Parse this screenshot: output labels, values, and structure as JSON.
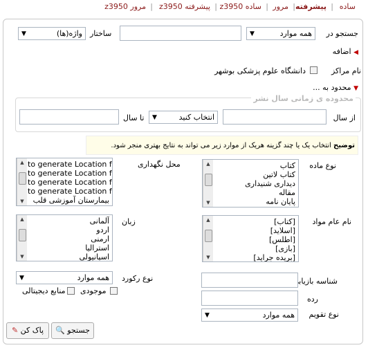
{
  "tabs": [
    {
      "label": "ساده"
    },
    {
      "label": "پیشرفته"
    },
    {
      "label": "مرور"
    },
    {
      "label": "z3950 ساده"
    },
    {
      "label": "z3950 پیشرفته"
    },
    {
      "label": "z3950 مرور"
    }
  ],
  "search": {
    "search_in_label": "جستجو در",
    "search_in_value": "همه موارد",
    "query_value": "",
    "structure_label": "ساختار",
    "structure_value": "واژه(ها)",
    "add_label": "اضافه"
  },
  "centers": {
    "label": "نام مراکز",
    "option": "دانشگاه علوم پزشکی بوشهر",
    "limit_label": "محدود به ..."
  },
  "year_range": {
    "legend": "محدوده ی زمانی سال نشر",
    "from_label": "از سال",
    "select_value": "انتخاب کنید",
    "to_label": "تا سال"
  },
  "hint": {
    "title": "توضیح",
    "text": "انتخاب یک یا چند گزینه هریک از موارد زیر می تواند به نتایج بهتری منجر شود."
  },
  "material_type": {
    "label": "نوع ماده",
    "items": [
      "کتاب",
      "کتاب لاتین",
      "دیداری شنیداری",
      "مقاله",
      "پایان نامه"
    ]
  },
  "location": {
    "label": "محل نگهداری",
    "items": [
      "to generate Location fo",
      "to generate Location fo",
      "to generate Location fo",
      "to generate Location fo",
      "بیمارستان آموزشی قلب"
    ]
  },
  "general_material": {
    "label": "نام عام مواد",
    "items": [
      "[کتاب]",
      "[اسلاید]",
      "[اطلس]",
      "[بازی]",
      "[بریده جراید]"
    ]
  },
  "language": {
    "label": "زبان",
    "items": [
      "آلمانی",
      "اردو",
      "ارمنی",
      "استرالیا",
      "اسپانیولی"
    ]
  },
  "record_type": {
    "label": "نوع رکورد",
    "value": "همه موارد",
    "available_label": "موجودی",
    "digital_label": "منابع دیجیتالی"
  },
  "retrieval_id": {
    "label": "شناسه بازیابی",
    "value": ""
  },
  "rank": {
    "label": "رده",
    "value": ""
  },
  "calendar": {
    "label": "نوع تقویم",
    "value": "همه موارد"
  },
  "buttons": {
    "search_label": "جستجو",
    "clear_label": "پاک کن"
  }
}
